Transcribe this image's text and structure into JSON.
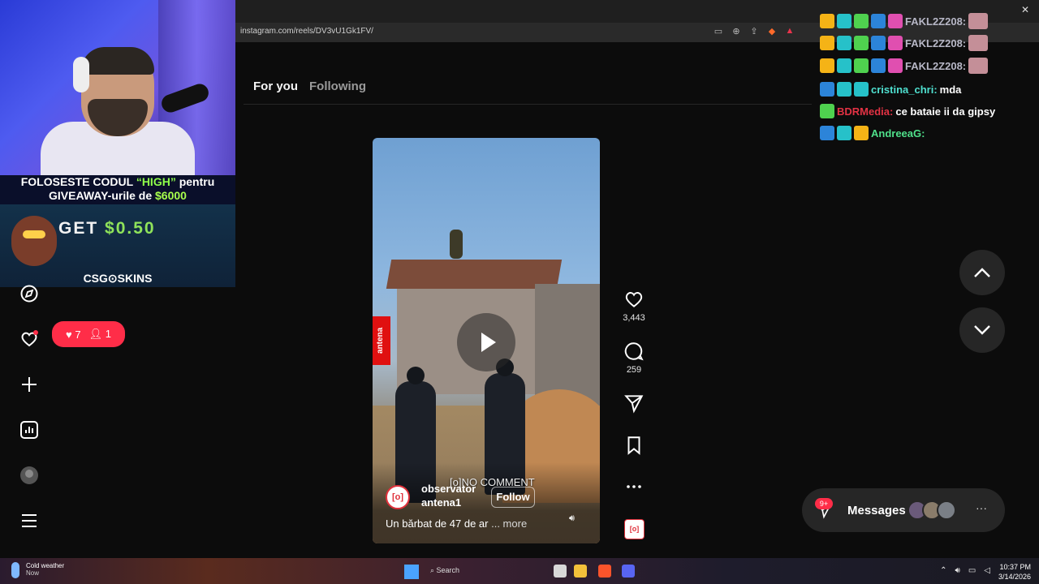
{
  "browser": {
    "url": "instagram.com/reels/DV3vU1Gk1FV/"
  },
  "stream_overlay": {
    "promo_line1_a": "FOLOSESTE CODUL ",
    "promo_code": "“HIGH”",
    "promo_line1_b": " pentru",
    "promo_line2_a": "GIVEAWAY-urile de ",
    "promo_amount": "$6000",
    "ad_get": "GET",
    "ad_amount": "$0.50",
    "ad_brand": "CSG⊙SKINS"
  },
  "sidebar": {
    "notifications": {
      "likes": "7",
      "follows": "1"
    }
  },
  "tabs": [
    {
      "label": "For you"
    },
    {
      "label": "Following"
    }
  ],
  "reel": {
    "channel_tag": "antena",
    "overlay_text": "[o]NO COMMENT",
    "author_name": "observator",
    "author_sub": "antena1",
    "author_logo": "[o]",
    "follow_label": "Follow",
    "caption": "Un bărbat de 47 de ar",
    "caption_more": "... more",
    "likes": "3,443",
    "comments": "259"
  },
  "chat": [
    {
      "user": "FAKL2Z208:",
      "message": ""
    },
    {
      "user": "FAKL2Z208:",
      "message": ""
    },
    {
      "user": "FAKL2Z208:",
      "message": ""
    },
    {
      "user": "cristina_chri:",
      "message": "mda"
    },
    {
      "user": "BDRMedia:",
      "message": "ce bataie ii da gipsy"
    },
    {
      "user": "AndreeaG:",
      "message": ""
    }
  ],
  "messages": {
    "label": "Messages",
    "count": "9+"
  },
  "taskbar": {
    "weather_title": "Cold weather",
    "weather_sub": "Now",
    "search": "Search",
    "time": "10:37 PM",
    "date": "3/14/2026"
  },
  "colors": {
    "badge_red": "#ff2d48",
    "link_red": "#e0313b"
  }
}
